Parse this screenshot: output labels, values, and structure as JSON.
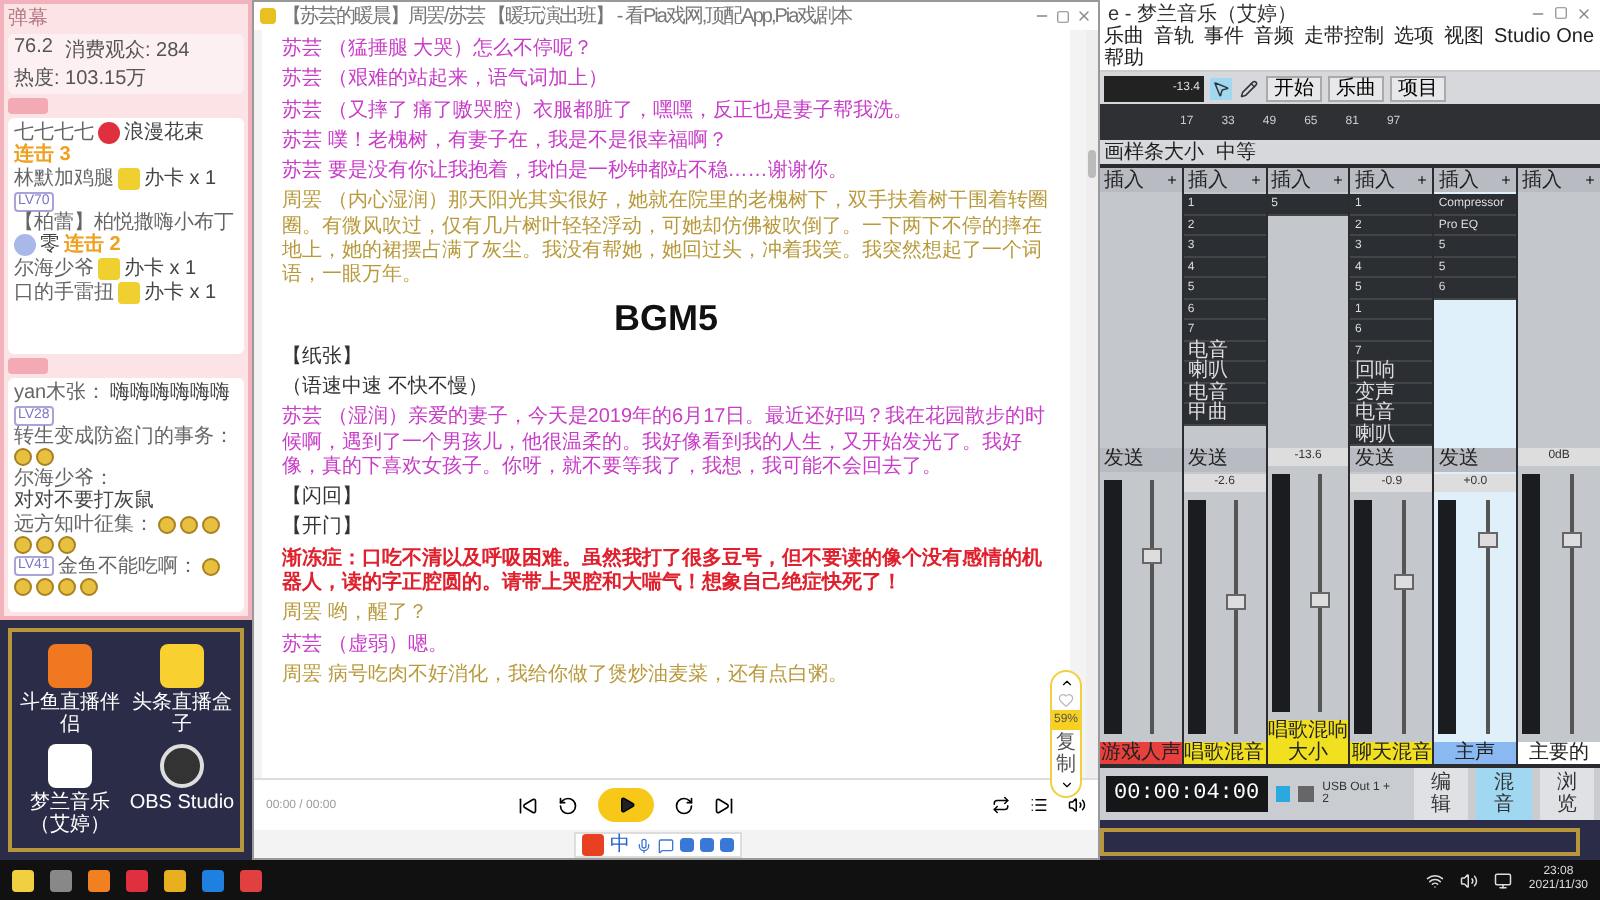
{
  "chat": {
    "title": "弹幕",
    "stats": [
      "76.2",
      "消费观众: 284",
      "热度: 103.15万"
    ],
    "gifts": [
      {
        "user": "七七七七",
        "kind": "flower",
        "gift": "浪漫花束",
        "combo": "连击 3"
      },
      {
        "user": "林默加鸡腿",
        "kind": "card",
        "gift": "办卡 x 1"
      },
      {
        "badge": "LV70",
        "user": "【柏蕾】柏悦撒嗨小布丁",
        "kind": "avatar",
        "gift": "零",
        "combo": "连击 2"
      },
      {
        "user": "尔海少爷",
        "kind": "card",
        "gift": "办卡 x 1"
      },
      {
        "user": "口的手雷扭",
        "kind": "card",
        "gift": "办卡 x 1"
      }
    ],
    "messages": [
      {
        "user": "yan木张：",
        "text": "嗨嗨嗨嗨嗨嗨"
      },
      {
        "badge": "LV28",
        "user": "转生变成防盗门的事务：",
        "stickers": [
          {
            "kind": "face"
          },
          {
            "kind": "face"
          }
        ]
      },
      {
        "user": "尔海少爷：",
        "text": "对对不要打灰鼠"
      },
      {
        "user": "远方知叶征集：",
        "stickers": [
          {
            "kind": "face"
          },
          {
            "kind": "face"
          },
          {
            "kind": "face"
          },
          {
            "kind": "face"
          },
          {
            "kind": "face"
          },
          {
            "kind": "face"
          }
        ]
      },
      {
        "badge": "LV41",
        "user": "金鱼不能吃啊：",
        "stickers": [
          {
            "kind": "face"
          },
          {
            "kind": "face"
          },
          {
            "kind": "face"
          },
          {
            "kind": "face"
          },
          {
            "kind": "face"
          }
        ]
      }
    ]
  },
  "desktop_icons": [
    {
      "kind": "douyu",
      "label": "斗鱼直播伴侣"
    },
    {
      "kind": "toutiao",
      "label": "头条直播盒子"
    },
    {
      "kind": "music",
      "label": "梦兰音乐（艾婷）"
    },
    {
      "kind": "obs",
      "label": "OBS Studio"
    }
  ],
  "doc": {
    "title": "【苏芸的暖晨】周罢/苏芸 【暖玩演出班】 - 看Pia戏网,顶配App,Pia戏剧本",
    "paragraphs": [
      {
        "kind": "dialogue",
        "color": "#c83cc8",
        "text": "苏芸 （猛捶腿 大哭）怎么不停呢？"
      },
      {
        "kind": "dialogue",
        "color": "#c83cc8",
        "text": "苏芸 （艰难的站起来，语气词加上）"
      },
      {
        "kind": "dialogue",
        "color": "#c83cc8",
        "text": "苏芸 （又摔了 痛了嗷哭腔）衣服都脏了，嘿嘿，反正也是妻子帮我洗。"
      },
      {
        "kind": "dialogue",
        "color": "#c83cc8",
        "text": "苏芸 噗！老槐树，有妻子在，我是不是很幸福啊？"
      },
      {
        "kind": "dialogue",
        "color": "#c83cc8",
        "text": "苏芸 要是没有你让我抱着，我怕是一秒钟都站不稳……谢谢你。"
      },
      {
        "kind": "dialogue",
        "color": "#b89a3c",
        "text": "周罢 （内心湿润）那天阳光其实很好，她就在院里的老槐树下，双手扶着树干围着转圈圈。有微风吹过，仅有几片树叶轻轻浮动，可她却仿佛被吹倒了。一下两下不停的摔在地上，她的裙摆占满了灰尘。我没有帮她，她回过头，冲着我笑。我突然想起了一个词语，一眼万年。"
      },
      {
        "kind": "heading",
        "text": "BGM5"
      },
      {
        "kind": "direction",
        "text": "【纸张】"
      },
      {
        "kind": "direction",
        "text": "（语速中速 不快不慢）"
      },
      {
        "kind": "dialogue",
        "color": "#c83cc8",
        "text": "苏芸 （湿润）亲爱的妻子，今天是2019年的6月17日。最近还好吗？我在花园散步的时候啊，遇到了一个男孩儿，他很温柔的。我好像看到我的人生，又开始发光了。我好像，真的下喜欢女孩子。你呀，就不要等我了，我想，我可能不会回去了。"
      },
      {
        "kind": "direction",
        "text": "【闪回】"
      },
      {
        "kind": "direction",
        "text": "【开门】"
      },
      {
        "kind": "alert",
        "text": "渐冻症：口吃不清以及呼吸困难。虽然我打了很多豆号，但不要读的像个没有感情的机器人，读的字正腔圆的。请带上哭腔和大喘气！想象自己绝症快死了！"
      },
      {
        "kind": "dialogue",
        "color": "#b89a3c",
        "text": "周罢 哟，醒了？"
      },
      {
        "kind": "dialogue",
        "color": "#c83cc8",
        "text": "苏芸 （虚弱）嗯。"
      },
      {
        "kind": "dialogue",
        "color": "#b89a3c",
        "text": "周罢 病号吃肉不好消化，我给你做了煲炒油麦菜，还有点白粥。"
      }
    ],
    "zoom": "59%",
    "copy": "复制",
    "time": "00:00 / 00:00"
  },
  "ime": {
    "mode": "中"
  },
  "daw": {
    "title": "e - 梦兰音乐（艾婷）",
    "menu": [
      "乐曲",
      "音轨",
      "事件",
      "音频",
      "走带控制",
      "选项",
      "视图",
      "Studio One",
      "帮助"
    ],
    "readout": "-13.4",
    "pages": [
      "开始",
      "乐曲",
      "项目"
    ],
    "ruler": [
      "17",
      "33",
      "49",
      "65",
      "81",
      "97"
    ],
    "zoom_label": "画样条大小",
    "mode_label": "中等",
    "strips": [
      {
        "insert": "插入",
        "send": "发送",
        "color": "#e8403c",
        "name": "游戏人声",
        "level": 0.7
      },
      {
        "insert": "插入",
        "slots": [
          "1",
          "2",
          "3",
          "4",
          "5",
          "6",
          "7",
          "电音",
          "喇叭",
          "电音",
          "甲曲"
        ],
        "send": "发送",
        "pan": "-2.6",
        "color": "#f0e020",
        "name": "唱歌混音",
        "level": 0.55
      },
      {
        "insert": "插入",
        "slots": [
          "5"
        ],
        "pan": "-13.6",
        "color": "#f0e020",
        "name": "唱歌混响大小",
        "level": 0.45
      },
      {
        "insert": "插入",
        "slots": [
          "1",
          "2",
          "3",
          "4",
          "5",
          "1",
          "6",
          "7",
          "回响",
          "变声",
          "电音",
          "喇叭"
        ],
        "send": "发送",
        "pan": "-0.9",
        "color": "#f0e020",
        "name": "聊天混音",
        "level": 0.65
      },
      {
        "insert": "插入",
        "slots": [
          "Compressor",
          "Pro EQ",
          "5",
          "5",
          "6"
        ],
        "send": "发送",
        "pan": "+0.0",
        "color": "#8ab8f0",
        "name": "主声",
        "level": 0.85
      },
      {
        "insert": "插入",
        "pan": "0dB",
        "color": "#ffffff",
        "name": "主要的",
        "level": 0.75
      }
    ],
    "output": "USB Out 1 + 2",
    "transport_time": "00:00:04:00",
    "views": [
      {
        "label": "编辑",
        "selected": false
      },
      {
        "label": "混音",
        "selected": true
      },
      {
        "label": "浏览",
        "selected": false
      }
    ]
  },
  "clock": {
    "time": "23:08",
    "date": "2021/11/30"
  }
}
